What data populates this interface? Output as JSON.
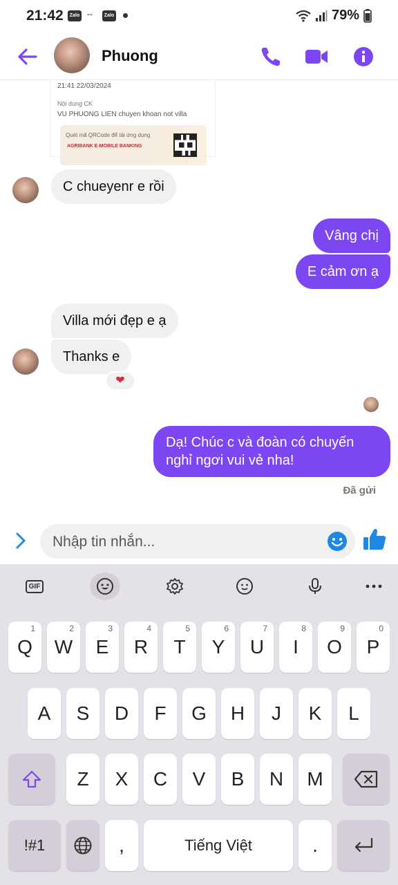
{
  "status_bar": {
    "time": "21:42",
    "app_badge_1": "Zalo",
    "arrows": "⇔",
    "app_badge_2": "Zalo",
    "battery": "79%"
  },
  "header": {
    "contact_name": "Phuong"
  },
  "receipt_card": {
    "datetime": "21:41 22/03/2024",
    "content_label": "Nội dung CK",
    "content_value": "VU PHUONG LIEN chuyen khoan not villa",
    "qr_prompt": "Quét mã QRCode để tải ứng dụng",
    "bank_logo": "AGRIBANK E-MOBILE BANKING"
  },
  "messages": [
    {
      "direction": "incoming",
      "text": "C chueyenr e rồi"
    },
    {
      "direction": "outgoing",
      "text": "Vâng chị"
    },
    {
      "direction": "outgoing",
      "text": "E cảm ơn ạ"
    },
    {
      "direction": "incoming",
      "text": "Villa mới đẹp e ạ"
    },
    {
      "direction": "incoming",
      "text": "Thanks e",
      "reaction": "❤"
    },
    {
      "direction": "outgoing",
      "text_line1": "Dạ! Chúc c và đoàn có chuyến",
      "text_line2": "nghỉ ngơi vui vẻ nha!"
    }
  ],
  "sent_status": "Đã gửi",
  "composer": {
    "placeholder": "Nhập tin nhắn..."
  },
  "keyboard": {
    "row1": [
      {
        "label": "Q",
        "num": "1"
      },
      {
        "label": "W",
        "num": "2"
      },
      {
        "label": "E",
        "num": "3"
      },
      {
        "label": "R",
        "num": "4"
      },
      {
        "label": "T",
        "num": "5"
      },
      {
        "label": "Y",
        "num": "6"
      },
      {
        "label": "U",
        "num": "7"
      },
      {
        "label": "I",
        "num": "8"
      },
      {
        "label": "O",
        "num": "9"
      },
      {
        "label": "P",
        "num": "0"
      }
    ],
    "row2": [
      "A",
      "S",
      "D",
      "F",
      "G",
      "H",
      "J",
      "K",
      "L"
    ],
    "row3": [
      "Z",
      "X",
      "C",
      "V",
      "B",
      "N",
      "M"
    ],
    "symbols_key": "!#1",
    "comma_key": ",",
    "space_key": "Tiếng Việt",
    "period_key": ".",
    "gif_tool": "GIF"
  },
  "colors": {
    "accent": "#7c46f2",
    "incoming_bubble": "#f0f0f0",
    "keyboard_bg": "#e5e1e9",
    "like_blue": "#1e88e5"
  }
}
